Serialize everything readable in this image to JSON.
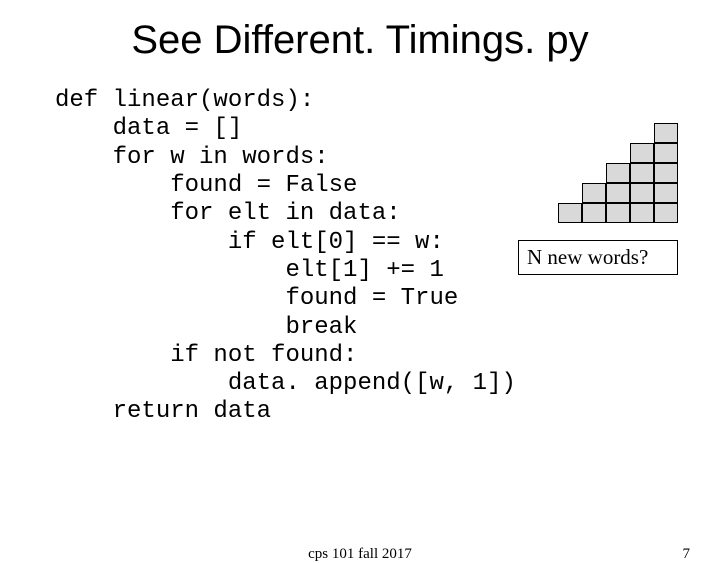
{
  "title": "See Different. Timings. py",
  "code": "def linear(words):\n    data = []\n    for w in words:\n        found = False\n        for elt in data:\n            if elt[0] == w:\n                elt[1] += 1\n                found = True\n                break\n        if not found:\n            data. append([w, 1])\n    return data",
  "annotation": "N new words?",
  "staircase_rows": [
    1,
    2,
    3,
    4,
    5
  ],
  "footer": {
    "center": "cps 101 fall 2017",
    "page": "7"
  }
}
